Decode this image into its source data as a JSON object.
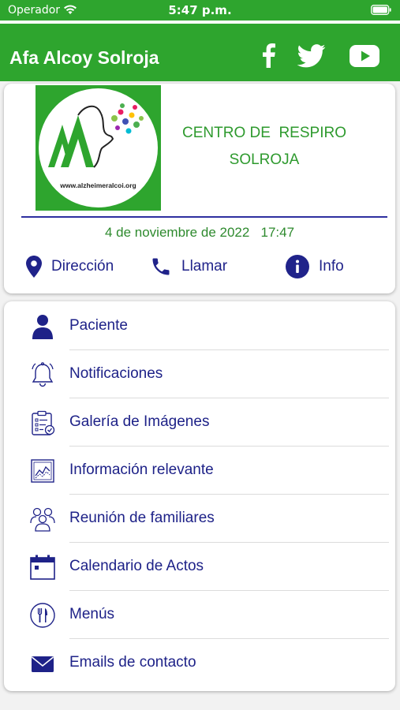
{
  "status_bar": {
    "carrier": "Operador",
    "time": "5:47 p.m."
  },
  "header": {
    "title": "Afa Alcoy Solroja",
    "social": [
      "facebook-icon",
      "twitter-icon",
      "youtube-icon"
    ]
  },
  "center": {
    "logo_url_text": "www.alzheimeralcoi.org",
    "name_line1": "CENTRO DE  RESPIRO",
    "name_line2": "SOLROJA",
    "date": "4 de noviembre de 2022",
    "time": "17:47"
  },
  "actions": [
    {
      "label": "Dirección",
      "icon": "location-pin-icon"
    },
    {
      "label": "Llamar",
      "icon": "phone-icon"
    },
    {
      "label": "Info",
      "icon": "info-icon"
    }
  ],
  "menu": [
    {
      "label": "Paciente",
      "icon": "person-icon"
    },
    {
      "label": "Notificaciones",
      "icon": "bell-icon"
    },
    {
      "label": "Galería de Imágenes",
      "icon": "clipboard-icon"
    },
    {
      "label": "Información relevante",
      "icon": "chart-icon"
    },
    {
      "label": "Reunión de familiares",
      "icon": "group-icon"
    },
    {
      "label": "Calendario de Actos",
      "icon": "calendar-icon"
    },
    {
      "label": "Menús",
      "icon": "cutlery-icon"
    },
    {
      "label": "Emails de contacto",
      "icon": "envelope-icon"
    }
  ],
  "colors": {
    "brand_green": "#2ea52e",
    "accent_blue": "#1e2288",
    "text_green": "#2e9a2e"
  }
}
